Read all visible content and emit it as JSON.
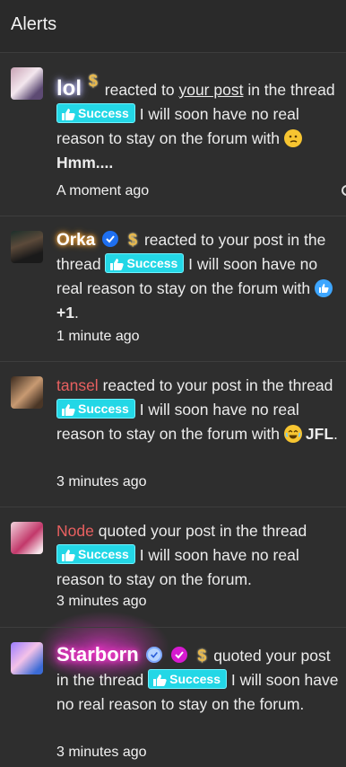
{
  "header": {
    "title": "Alerts"
  },
  "alerts": [
    {
      "username": "lol",
      "pre_link": "reacted to ",
      "link": "your post",
      "post_link": " in the thread ",
      "prefix_label": "Success",
      "thread_title": " I will soon have no real reason to stay on the forum with ",
      "reaction_label": "Hmm....",
      "time": "A moment ago",
      "dollar": "$"
    },
    {
      "username": "Orka",
      "text_a": "reacted to your post in the thread ",
      "prefix_label": "Success",
      "thread_title": " I will soon have no real reason to stay on the forum with ",
      "reaction_label": "+1",
      "end": ".",
      "time": "1 minute ago",
      "dollar": "$"
    },
    {
      "username": "tansel",
      "text_a": " reacted to your post in the thread ",
      "prefix_label": "Success",
      "thread_title": " I will soon have no real reason to stay on the forum with ",
      "reaction_label": "JFL",
      "end": ".",
      "time": "3 minutes ago"
    },
    {
      "username": "Node",
      "text_a": " quoted your post in the thread ",
      "prefix_label": "Success",
      "thread_title": " I will soon have no real reason to stay on the forum.",
      "time": "3 minutes ago"
    },
    {
      "username": "Starborn",
      "text_a": " quoted your post in the thread ",
      "prefix_label": "Success",
      "thread_title": " I will soon have no real reason to stay on the forum.",
      "time": "3 minutes ago",
      "dollar": "$"
    }
  ],
  "colors": {
    "background": "#2e2e2e",
    "success_badge": "#23d7e6",
    "username_red": "#e86060",
    "verified_blue": "#1e6ff0",
    "star_glow": "#ff3cd4"
  },
  "icons": [
    "thumbs-up-icon",
    "verified-badge-icon",
    "dollar-icon",
    "thinking-emoji-icon",
    "like-reaction-icon",
    "laughing-emoji-icon"
  ]
}
